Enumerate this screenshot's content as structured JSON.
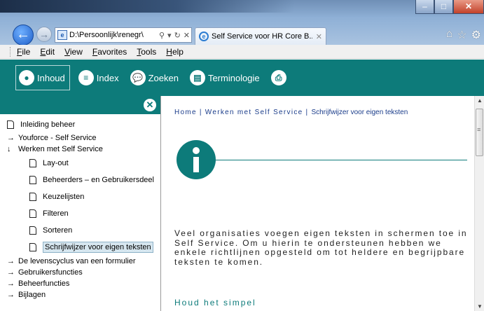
{
  "browser": {
    "address": "D:\\Persoonlijk\\renegr\\",
    "tab_label": "Self Service voor HR Core B...",
    "tab_close": "✕",
    "stop": "✕"
  },
  "menu": [
    "File",
    "Edit",
    "View",
    "Favorites",
    "Tools",
    "Help"
  ],
  "help_toolbar": {
    "items": [
      {
        "label": "Inhoud",
        "icon": "user-icon",
        "active": true
      },
      {
        "label": "Index",
        "icon": "list-icon"
      },
      {
        "label": "Zoeken",
        "icon": "speech-bubble-icon"
      },
      {
        "label": "Terminologie",
        "icon": "book-icon"
      },
      {
        "label": "",
        "icon": "printer-icon"
      }
    ]
  },
  "nav": {
    "items": [
      {
        "label": "Inleiding beheer",
        "type": "doc"
      },
      {
        "label": "Youforce - Self Service",
        "type": "collapsed"
      },
      {
        "label": "Werken met Self Service",
        "type": "expanded"
      },
      {
        "label": "Lay-out",
        "type": "doc",
        "child": true
      },
      {
        "label": "Beheerders – en Gebruikersdeel",
        "type": "doc",
        "child": true
      },
      {
        "label": "Keuzelijsten",
        "type": "doc",
        "child": true
      },
      {
        "label": "Filteren",
        "type": "doc",
        "child": true
      },
      {
        "label": "Sorteren",
        "type": "doc",
        "child": true
      },
      {
        "label": "Schrijfwijzer voor eigen teksten",
        "type": "doc",
        "child": true,
        "selected": true
      },
      {
        "label": "De levenscyclus van een formulier",
        "type": "collapsed"
      },
      {
        "label": "Gebruikersfuncties",
        "type": "collapsed"
      },
      {
        "label": "Beheerfuncties",
        "type": "collapsed"
      },
      {
        "label": "Bijlagen",
        "type": "collapsed"
      }
    ]
  },
  "content": {
    "breadcrumb": [
      "Home",
      "Werken met Self Service",
      "Schrijfwijzer voor eigen teksten"
    ],
    "separator": "|",
    "paragraph": "Veel organisaties voegen eigen teksten in schermen toe in Self Service. Om u hierin te ondersteunen hebben we enkele richtlijnen opgesteld om tot heldere en begrijpbare teksten te komen.",
    "subheading": "Houd het simpel"
  },
  "colors": {
    "accent": "#0d7b7a",
    "breadcrumb": "#1a3c8a"
  }
}
